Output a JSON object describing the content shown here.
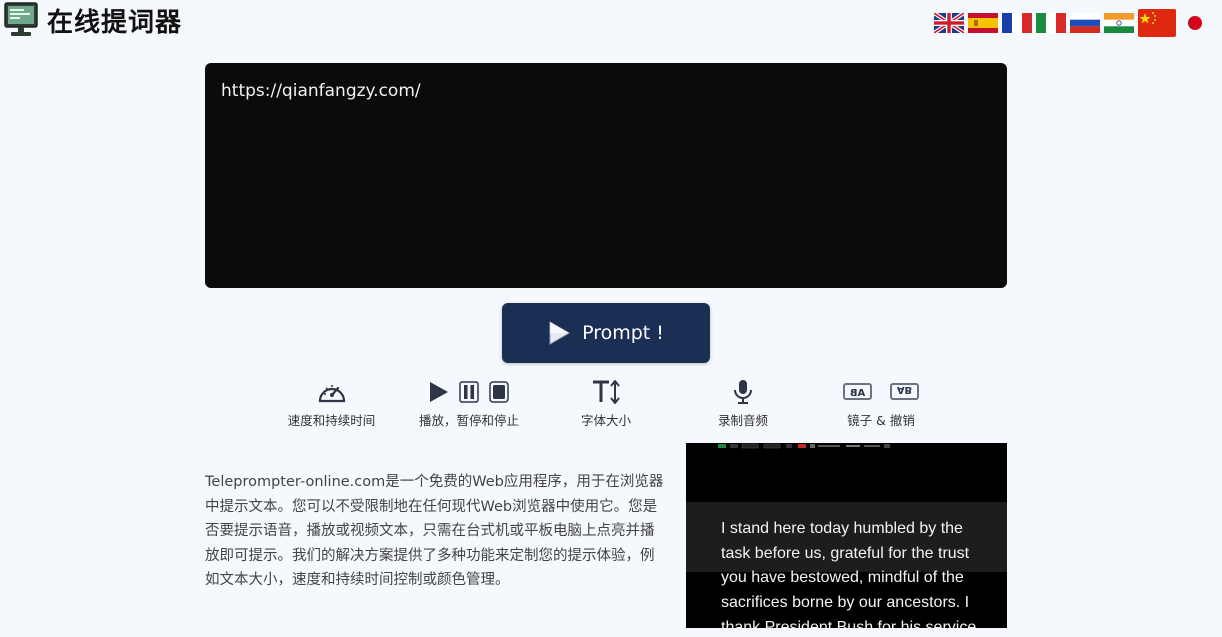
{
  "header": {
    "title": "在线提词器"
  },
  "languages": [
    {
      "code": "en",
      "icon": "uk-flag-icon"
    },
    {
      "code": "es",
      "icon": "spain-flag-icon"
    },
    {
      "code": "fr",
      "icon": "france-flag-icon"
    },
    {
      "code": "it",
      "icon": "italy-flag-icon"
    },
    {
      "code": "ru",
      "icon": "russia-flag-icon"
    },
    {
      "code": "in",
      "icon": "india-flag-icon"
    },
    {
      "code": "zh",
      "icon": "china-flag-icon"
    },
    {
      "code": "ja",
      "icon": "japan-flag-icon"
    }
  ],
  "editor": {
    "value": "https://qianfangzy.com/"
  },
  "prompt_button": {
    "label": "Prompt !"
  },
  "features": [
    {
      "label": "速度和持续时间",
      "icon": "speedometer-icon"
    },
    {
      "label": "播放，暂停和停止",
      "icon": "play-pause-stop-icon"
    },
    {
      "label": "字体大小",
      "icon": "font-size-icon"
    },
    {
      "label": "录制音频",
      "icon": "microphone-icon"
    },
    {
      "label": "镜子 & 撤销",
      "icon": "mirror-icon"
    }
  ],
  "description": "Teleprompter-online.com是一个免费的Web应用程序，用于在浏览器中提示文本。您可以不受限制地在任何现代Web浏览器中使用它。您是否要提示语音，播放或视频文本，只需在台式机或平板电脑上点亮并播放即可提示。我们的解决方案提供了多种功能来定制您的提示体验，例如文本大小，速度和持续时间控制或颜色管理。",
  "preview": {
    "text": "I stand here today humbled by the task before us, grateful for the trust you have bestowed, mindful of the sacrifices borne by our ancestors. I thank President Bush for his service"
  },
  "colors": {
    "background": "#f5f8fc",
    "editor_bg": "#0b0b0c",
    "button_bg": "#1b2f55",
    "icon_color": "#2e3546"
  }
}
